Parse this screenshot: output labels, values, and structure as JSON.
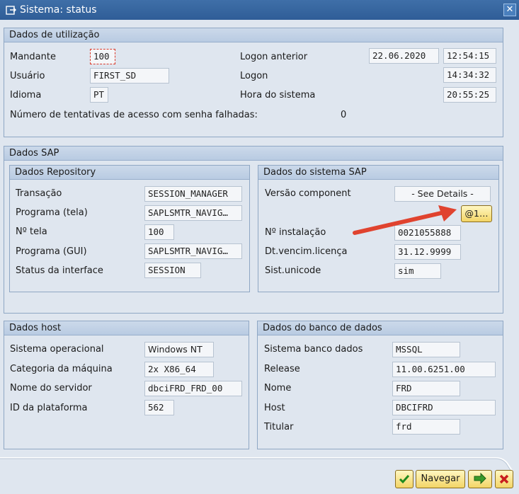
{
  "window": {
    "title": "Sistema: status",
    "close_glyph": "✕"
  },
  "usage": {
    "title": "Dados de utilização",
    "client_label": "Mandante",
    "client_value": "100",
    "user_label": "Usuário",
    "user_value": "FIRST_SD",
    "language_label": "Idioma",
    "language_value": "PT",
    "prev_logon_label": "Logon anterior",
    "prev_logon_date": "22.06.2020",
    "prev_logon_time": "12:54:15",
    "logon_label": "Logon",
    "logon_time": "14:34:32",
    "system_time_label": "Hora do sistema",
    "system_time": "20:55:25",
    "failed_label": "Número de tentativas de acesso com senha falhadas:",
    "failed_value": "0"
  },
  "sap": {
    "title": "Dados SAP",
    "repository": {
      "title": "Dados Repository",
      "transaction_label": "Transação",
      "transaction_value": "SESSION_MANAGER",
      "program_screen_label": "Programa (tela)",
      "program_screen_value": "SAPLSMTR_NAVIG…",
      "screen_no_label": "Nº tela",
      "screen_no_value": "100",
      "program_gui_label": "Programa (GUI)",
      "program_gui_value": "SAPLSMTR_NAVIG…",
      "interface_status_label": "Status da interface",
      "interface_status_value": "SESSION"
    },
    "system": {
      "title": "Dados do sistema SAP",
      "component_label": "Versão component",
      "component_value": "- See Details -",
      "details_button": "@1…",
      "install_label": "Nº instalação",
      "install_value": "0021055888",
      "license_label": "Dt.vencim.licença",
      "license_value": "31.12.9999",
      "unicode_label": "Sist.unicode",
      "unicode_value": "sim"
    }
  },
  "host": {
    "title": "Dados host",
    "os_label": "Sistema operacional",
    "os_value": "Windows NT",
    "machine_label": "Categoria da máquina",
    "machine_value": "2x X86_64",
    "server_label": "Nome do servidor",
    "server_value": "dbciFRD_FRD_00",
    "platform_label": "ID da plataforma",
    "platform_value": "562"
  },
  "db": {
    "title": "Dados do banco de dados",
    "system_label": "Sistema banco dados",
    "system_value": "MSSQL",
    "release_label": "Release",
    "release_value": "11.00.6251.00",
    "name_label": "Nome",
    "name_value": "FRD",
    "host_label": "Host",
    "host_value": "DBCIFRD",
    "owner_label": "Titular",
    "owner_value": "frd"
  },
  "footer": {
    "navigate_label": "Navegar"
  },
  "colors": {
    "arrow": "#e0432f",
    "title_bar": "#2f5d97",
    "panel": "#dfe6ef"
  },
  "icons": [
    "window-icon",
    "close-icon",
    "check-icon",
    "forward-icon",
    "cancel-icon",
    "annotation-arrow"
  ]
}
